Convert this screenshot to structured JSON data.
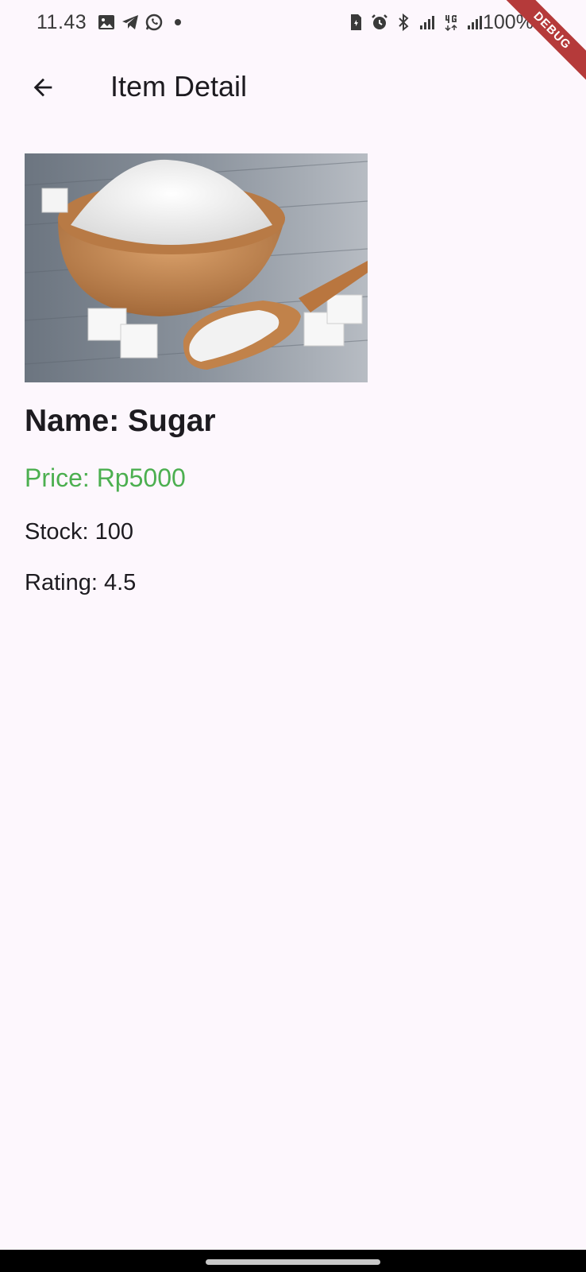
{
  "status_bar": {
    "time": "11.43",
    "battery": "100%",
    "left_icons": [
      "gallery-icon",
      "telegram-icon",
      "whatsapp-icon",
      "dot-icon"
    ],
    "right_icons": [
      "sim-icon",
      "alarm-icon",
      "bluetooth-icon",
      "signal-icon",
      "4g-icon",
      "signal-icon"
    ]
  },
  "debug_banner": "DEBUG",
  "app_bar": {
    "title": "Item Detail",
    "back_icon": "arrow-back-icon"
  },
  "item": {
    "image_subject": "sugar bowl with wooden scoop",
    "name": "Name: Sugar",
    "price": "Price: Rp5000",
    "stock": "Stock: 100",
    "rating": "Rating: 4.5"
  },
  "colors": {
    "background": "#fdf7fd",
    "price": "#4caf50",
    "text": "#1d1b20"
  }
}
